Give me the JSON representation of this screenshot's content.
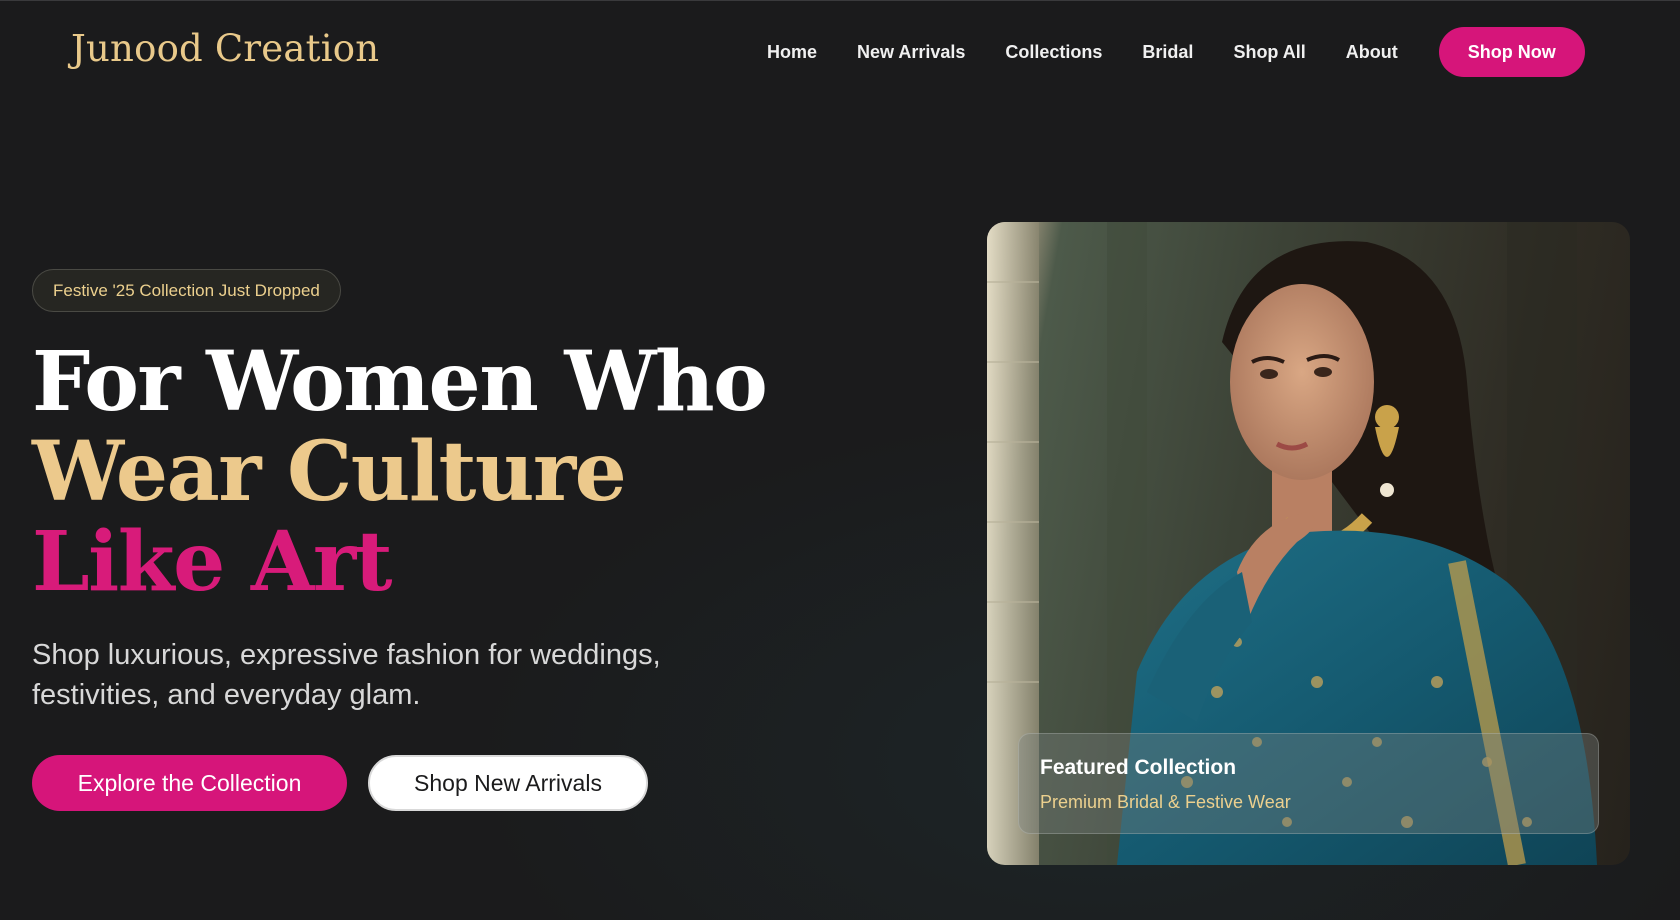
{
  "brand": {
    "name": "Junood Creation"
  },
  "nav": {
    "links": [
      "Home",
      "New Arrivals",
      "Collections",
      "Bridal",
      "Shop All",
      "About"
    ],
    "cta_label": "Shop Now"
  },
  "hero": {
    "badge": "Festive '25 Collection Just Dropped",
    "headline": {
      "line1": "For Women Who",
      "line2": "Wear Culture",
      "line3": "Like Art"
    },
    "subcopy": "Shop luxurious, expressive fashion for weddings, festivities, and everyday glam.",
    "primary_button": "Explore the Collection",
    "secondary_button": "Shop New Arrivals"
  },
  "featured": {
    "title": "Featured Collection",
    "subtitle": "Premium Bridal & Festive Wear",
    "image_icon": "model-photo-icon"
  },
  "colors": {
    "accent_pink": "#d6157a",
    "accent_gold": "#ecc98c",
    "background": "#1b1b1c"
  }
}
